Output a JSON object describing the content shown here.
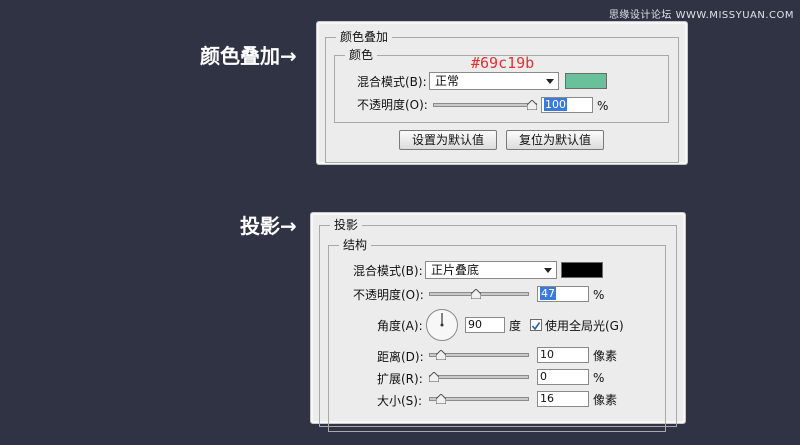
{
  "watermark": "思缘设计论坛 WWW.MISSYUAN.COM",
  "labels": {
    "color_overlay_side": "颜色叠加→",
    "drop_shadow_side": "投影→"
  },
  "color_overlay": {
    "title": "颜色叠加",
    "section": "颜色",
    "hex_annotation": "#69c19b",
    "blend_mode_label": "混合模式(B):",
    "blend_mode_value": "正常",
    "swatch_color": "#69c19b",
    "opacity_label": "不透明度(O):",
    "opacity_value": "100",
    "opacity_fraction": 1.0,
    "opacity_unit": "%",
    "btn_set_default": "设置为默认值",
    "btn_reset_default": "复位为默认值"
  },
  "drop_shadow": {
    "title": "投影",
    "section": "结构",
    "blend_mode_label": "混合模式(B):",
    "blend_mode_value": "正片叠底",
    "swatch_color": "#000000",
    "opacity_label": "不透明度(O):",
    "opacity_value": "47",
    "opacity_fraction": 0.47,
    "opacity_unit": "%",
    "angle_label": "角度(A):",
    "angle_value": "90",
    "angle_unit": "度",
    "global_light_label": "使用全局光(G)",
    "global_light_checked": true,
    "distance_label": "距离(D):",
    "distance_value": "10",
    "distance_fraction": 0.08,
    "distance_unit": "像素",
    "spread_label": "扩展(R):",
    "spread_value": "0",
    "spread_fraction": 0.0,
    "spread_unit": "%",
    "size_label": "大小(S):",
    "size_value": "16",
    "size_fraction": 0.08,
    "size_unit": "像素"
  }
}
